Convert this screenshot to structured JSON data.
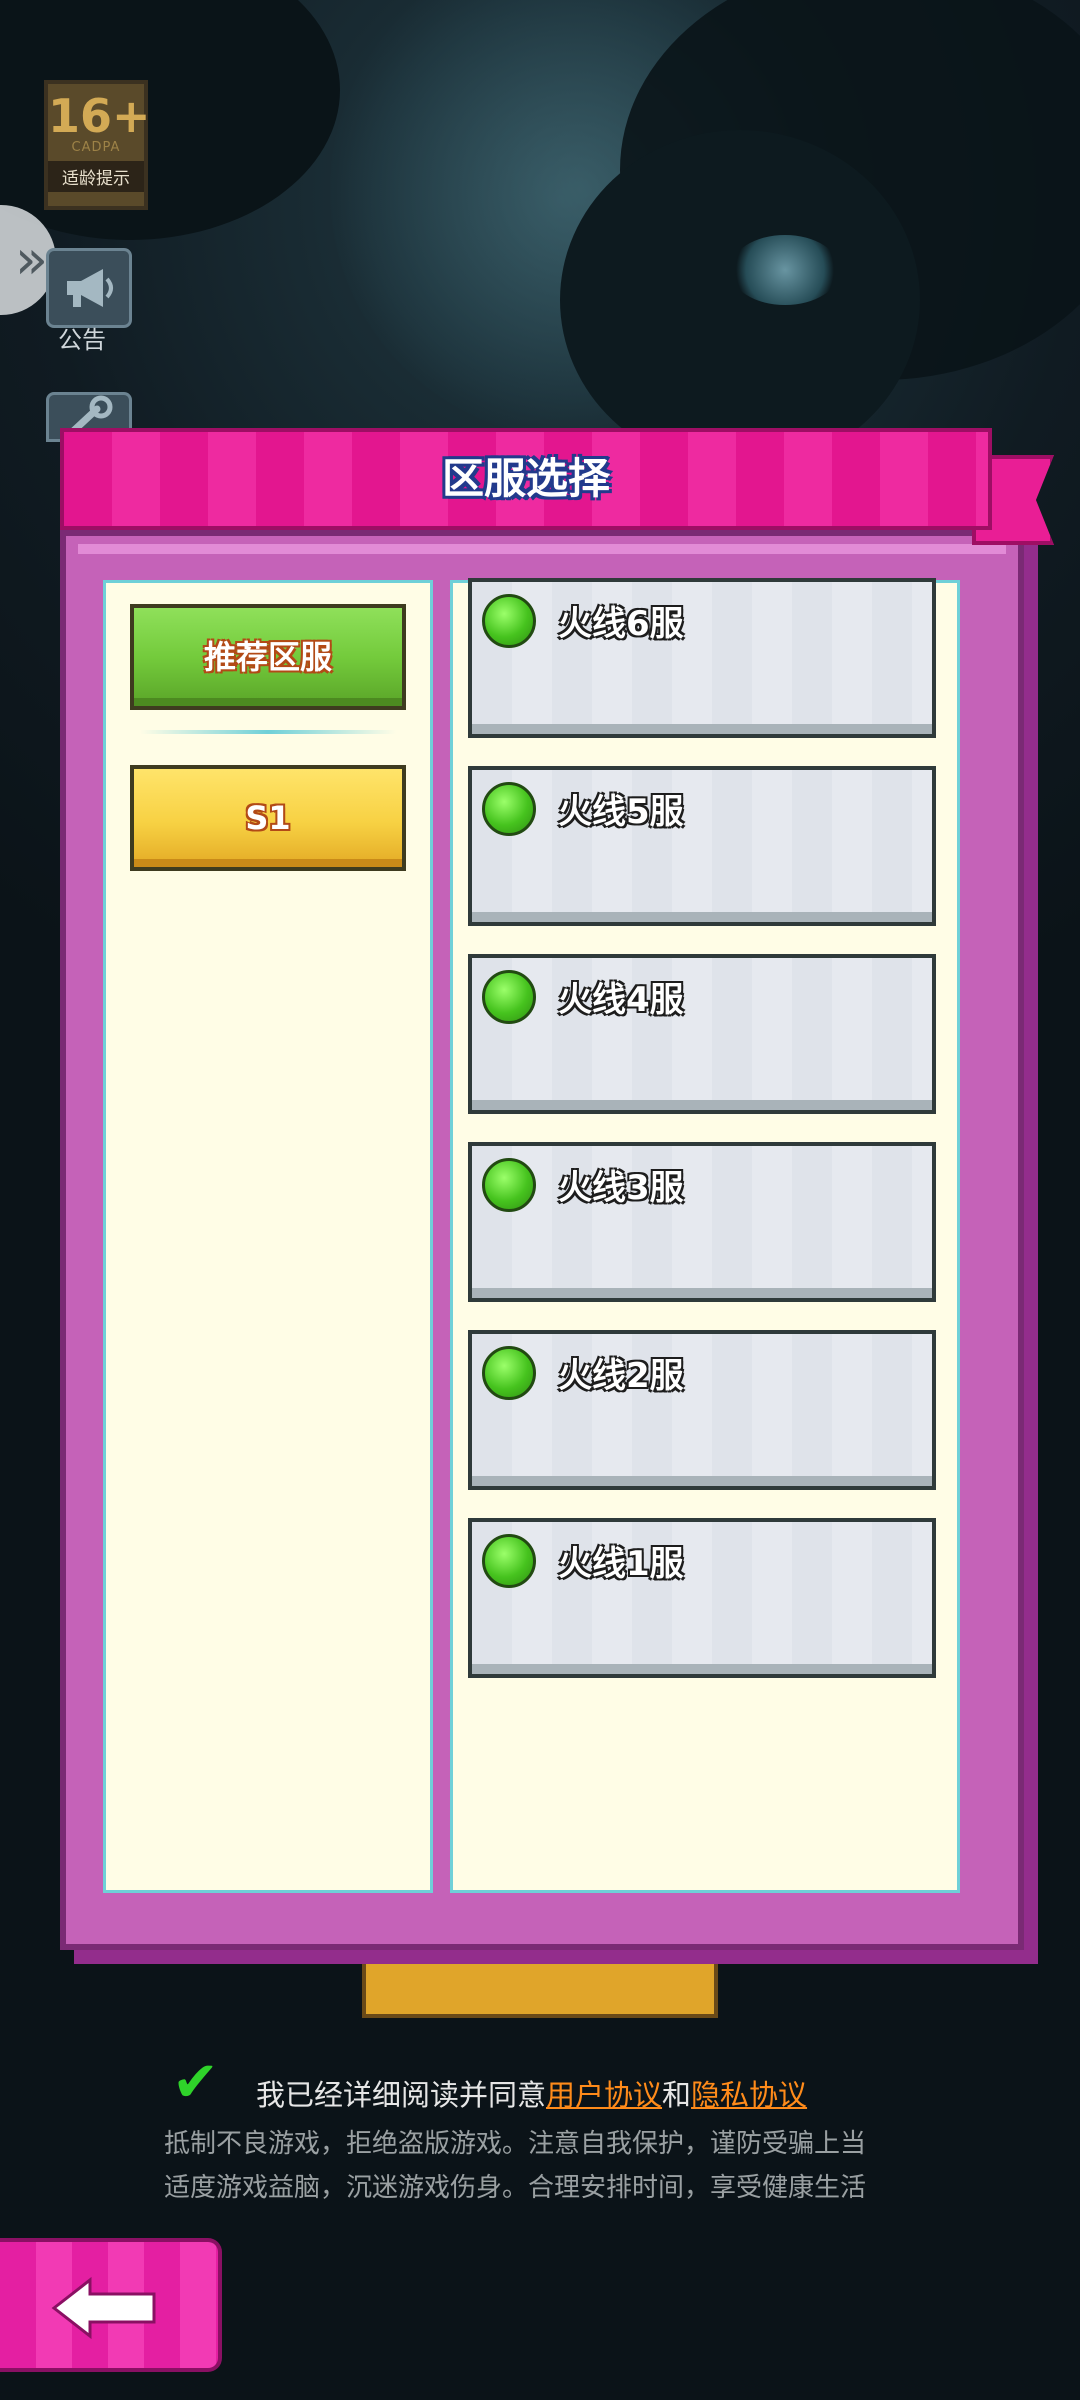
{
  "rating": {
    "age": "16+",
    "org": "CADPA",
    "tip": "适龄提示"
  },
  "side_menu": {
    "notice_label": "公告"
  },
  "dialog": {
    "title": "区服选择",
    "tabs": [
      {
        "label": "推荐区服",
        "selected": true
      },
      {
        "label": "S1",
        "selected": false
      }
    ],
    "servers": [
      {
        "name": "火线6服",
        "status": "green"
      },
      {
        "name": "火线5服",
        "status": "green"
      },
      {
        "name": "火线4服",
        "status": "green"
      },
      {
        "name": "火线3服",
        "status": "green"
      },
      {
        "name": "火线2服",
        "status": "green"
      },
      {
        "name": "火线1服",
        "status": "green"
      }
    ]
  },
  "agreement": {
    "checked": true,
    "prefix": "我已经详细阅读并同意",
    "user_agreement": "用户协议",
    "and": "和",
    "privacy_agreement": "隐私协议"
  },
  "health_notice": {
    "line1": "抵制不良游戏，拒绝盗版游戏。注意自我保护，谨防受骗上当",
    "line2": "适度游戏益脑，沉迷游戏伤身。合理安排时间，享受健康生活"
  },
  "colors": {
    "header_pink": "#e3168f",
    "dialog_purple": "#c562b8",
    "panel_cream": "#fffde6",
    "tab_green": "#74cb3c",
    "tab_yellow": "#f7d143",
    "status_green": "#46c31e",
    "link_orange": "#ff8b1a"
  },
  "icons": [
    "chevron-right-icon",
    "megaphone-icon",
    "wrench-icon",
    "checkmark-icon",
    "back-arrow-icon",
    "server-status-icon"
  ]
}
